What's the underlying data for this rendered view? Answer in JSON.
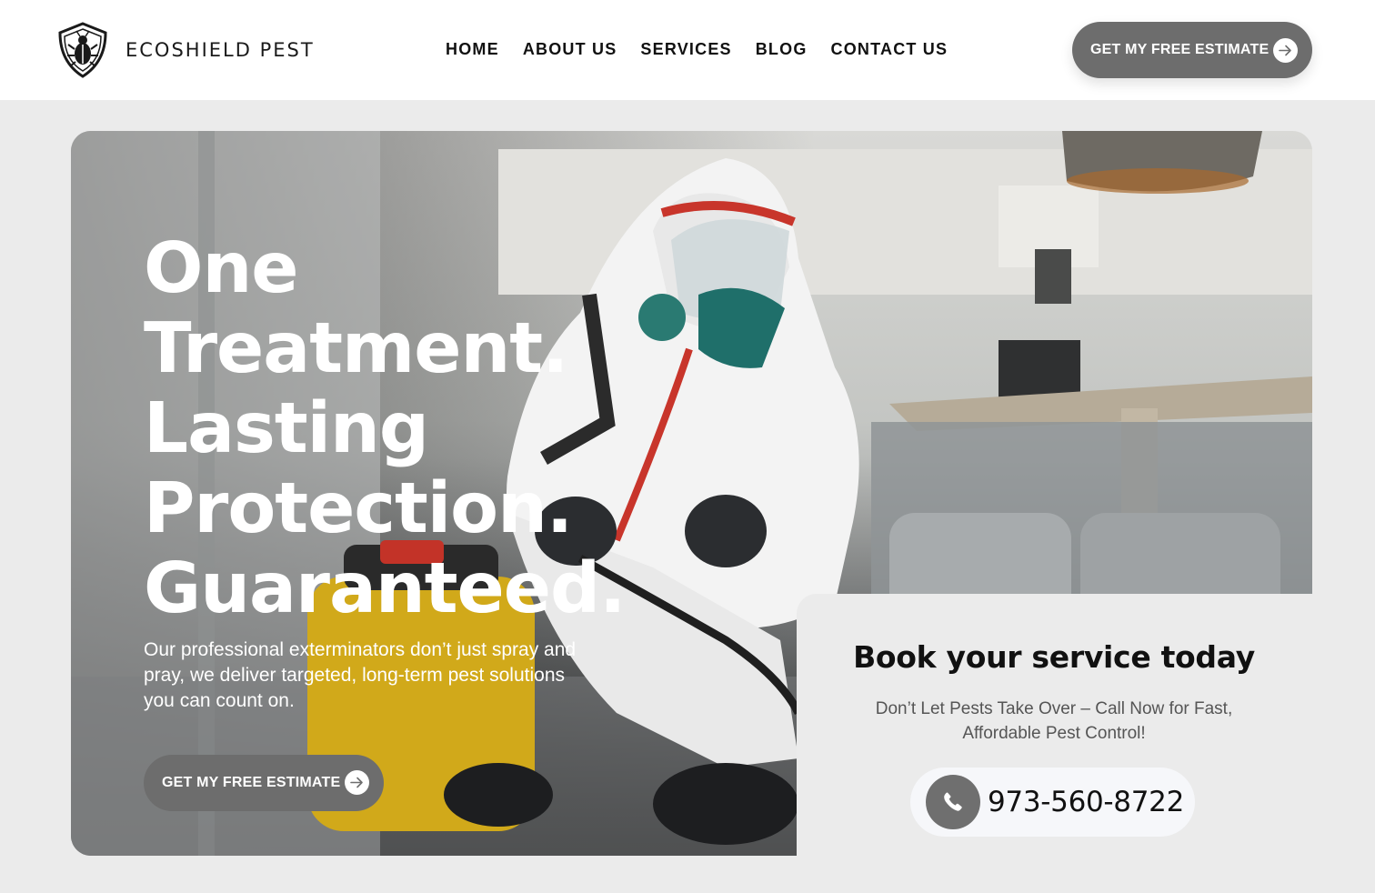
{
  "brand": {
    "name": "ECOSHIELD PEST",
    "logo_icon": "shield-bug-icon"
  },
  "nav": {
    "items": [
      {
        "label": "HOME"
      },
      {
        "label": "ABOUT US"
      },
      {
        "label": "SERVICES"
      },
      {
        "label": "BLOG"
      },
      {
        "label": "CONTACT US"
      }
    ]
  },
  "header_cta": {
    "label": "GET MY FREE ESTIMATE",
    "icon": "arrow-right-icon"
  },
  "hero": {
    "title_lines": [
      "One",
      "Treatment.",
      "Lasting",
      "Protection.",
      "Guaranteed."
    ],
    "subtitle": "Our professional exterminators don’t just spray and pray, we deliver targeted, long-term pest solutions you can count on.",
    "cta_label": "GET MY FREE ESTIMATE",
    "image": "exterminator-in-protective-suit-spraying-photo"
  },
  "booking": {
    "title": "Book your service today",
    "subtitle": "Don’t Let Pests Take Over – Call Now for Fast, Affordable Pest Control!",
    "phone": "973-560-8722",
    "phone_icon": "phone-icon"
  },
  "colors": {
    "button_gray": "#6d6d6d",
    "page_bg": "#ebebeb",
    "header_bg": "#ffffff"
  }
}
